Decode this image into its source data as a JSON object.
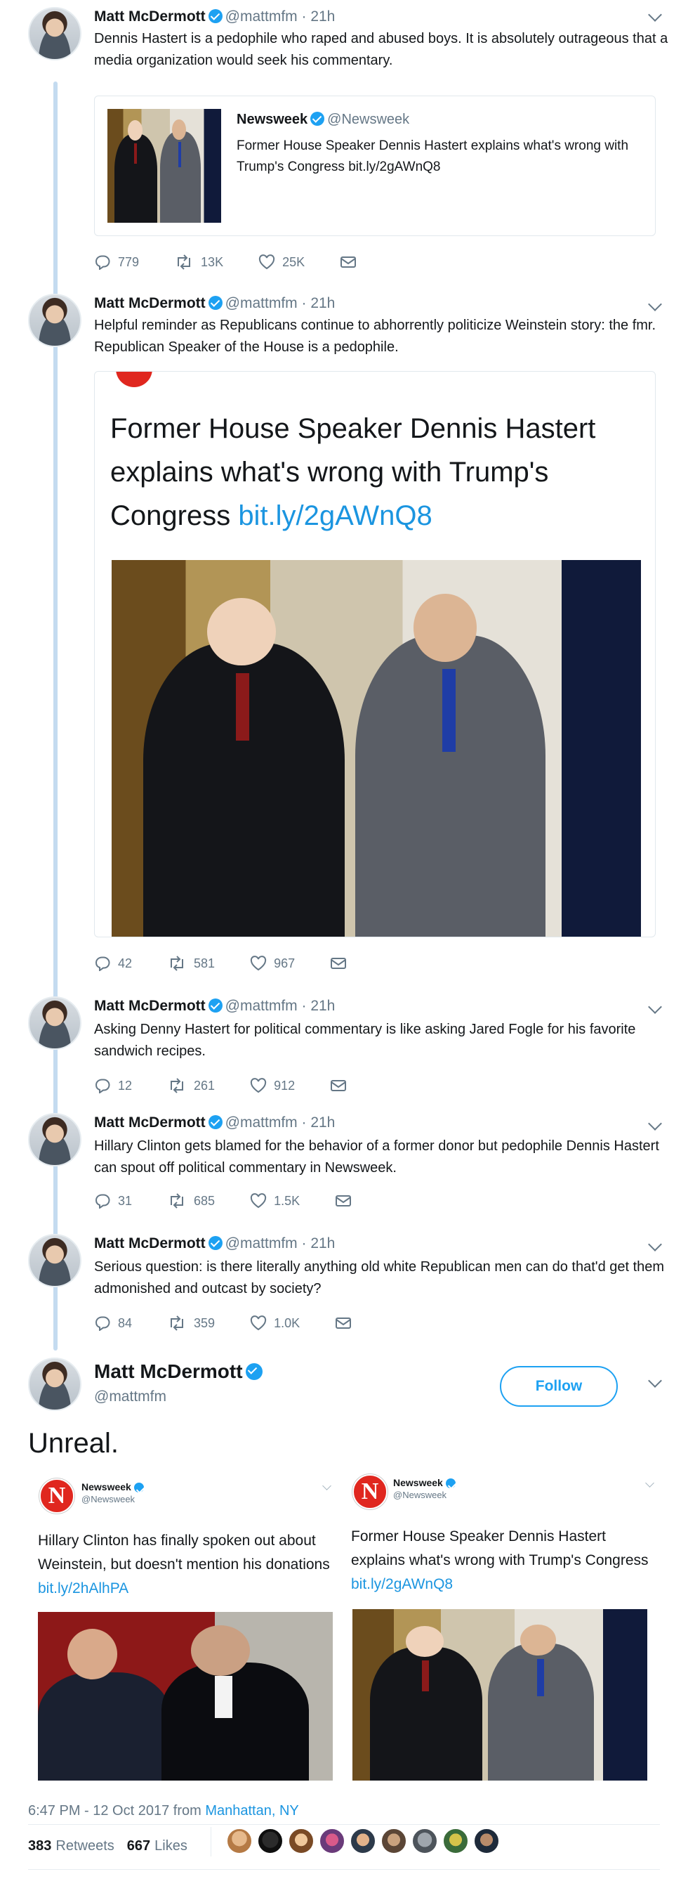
{
  "tweets": [
    {
      "name": "Matt McDermott",
      "handle": "@mattmfm",
      "time": "· 21h",
      "text": "Dennis Hastert is a pedophile who raped and abused boys. It is absolutely outrageous that a media organization would seek his commentary.",
      "quote": {
        "name": "Newsweek",
        "handle": "@Newsweek",
        "text": "Former House Speaker Dennis Hastert explains what's wrong with Trump's Congress ",
        "link": "bit.ly/2gAWnQ8"
      },
      "replies": "779",
      "retweets": "13K",
      "likes": "25K"
    },
    {
      "name": "Matt McDermott",
      "handle": "@mattmfm",
      "time": "· 21h",
      "text": "Helpful reminder as Republicans continue to abhorrently politicize Weinstein story: the fmr. Republican Speaker of the House is a pedophile.",
      "card": {
        "headline": "Former House Speaker Dennis Hastert explains what's wrong with Trump's Congress ",
        "link": "bit.ly/2gAWnQ8"
      },
      "replies": "42",
      "retweets": "581",
      "likes": "967"
    },
    {
      "name": "Matt McDermott",
      "handle": "@mattmfm",
      "time": "· 21h",
      "text": "Asking Denny Hastert for political commentary is like asking Jared Fogle for his favorite sandwich recipes.",
      "replies": "12",
      "retweets": "261",
      "likes": "912"
    },
    {
      "name": "Matt McDermott",
      "handle": "@mattmfm",
      "time": "· 21h",
      "text": "Hillary Clinton gets blamed for the behavior of a former donor but pedophile Dennis Hastert can spout off political commentary in Newsweek.",
      "replies": "31",
      "retweets": "685",
      "likes": "1.5K"
    },
    {
      "name": "Matt McDermott",
      "handle": "@mattmfm",
      "time": "· 21h",
      "text": "Serious question: is there literally anything old white Republican men can do that'd get them admonished and outcast by society?",
      "replies": "84",
      "retweets": "359",
      "likes": "1.0K"
    }
  ],
  "main": {
    "name": "Matt McDermott",
    "handle": "@mattmfm",
    "follow_label": "Follow",
    "text": "Unreal.",
    "left_embed": {
      "logo": "N",
      "name": "Newsweek",
      "handle": "@Newsweek",
      "text": "Hillary Clinton has finally spoken out about Weinstein, but doesn't mention his donations ",
      "link": "bit.ly/2hAlhPA"
    },
    "right_embed": {
      "logo": "N",
      "name": "Newsweek",
      "handle": "@Newsweek",
      "text": "Former House Speaker Dennis Hastert explains what's wrong with Trump's Congress ",
      "link": "bit.ly/2gAWnQ8"
    },
    "timestamp": "6:47 PM - 12 Oct 2017 from ",
    "location": "Manhattan, NY",
    "retweets_count": "383",
    "retweets_label": "Retweets",
    "likes_count": "667",
    "likes_label": "Likes"
  },
  "colors": {
    "accent": "#1da1f2",
    "link": "#1b95e0",
    "newsweek_red": "#e0271f"
  }
}
